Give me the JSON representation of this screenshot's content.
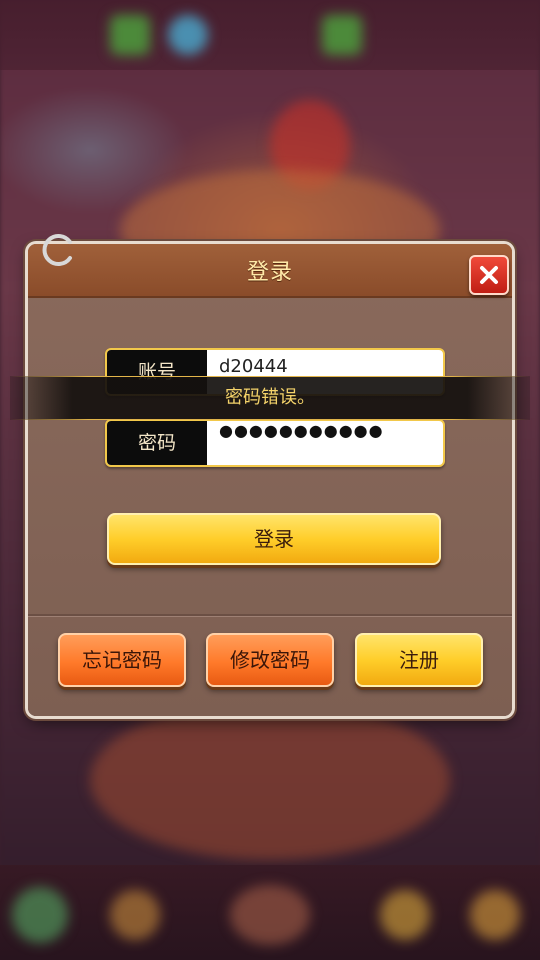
{
  "dialog": {
    "title": "登录",
    "account": {
      "label": "账号",
      "value": "d20444"
    },
    "password": {
      "label": "密码",
      "value": "●●●●●●●●●●●"
    },
    "login_button": "登录",
    "footer_buttons": {
      "forgot": "忘记密码",
      "change": "修改密码",
      "register": "注册"
    }
  },
  "toast": {
    "message": "密码错误。"
  },
  "icons": {
    "close": "close-icon",
    "loading": "loading-spinner-icon"
  },
  "colors": {
    "header": "#8a4c2a",
    "primary_button": "#ffce2a",
    "secondary_button": "#ff7a2a",
    "toast_text": "#f4d36a"
  }
}
